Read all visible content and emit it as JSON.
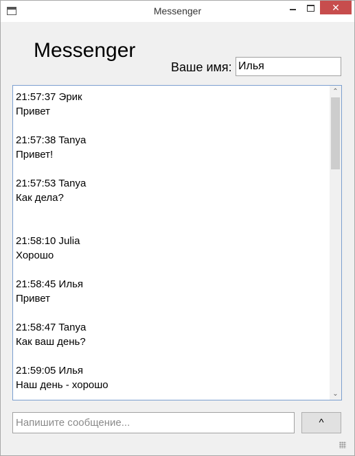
{
  "window": {
    "title": "Messenger",
    "close_glyph": "✕",
    "icons": [
      "app-icon",
      "minimize-icon",
      "maximize-icon",
      "close-icon"
    ]
  },
  "header": {
    "title": "Messenger",
    "name_label": "Ваше имя:",
    "name_value": "Илья"
  },
  "messages": [
    {
      "header": "21:57:37 Эрик",
      "text": "Привет"
    },
    {
      "header": "21:57:38 Tanya",
      "text": "Привет!"
    },
    {
      "header": "21:57:53 Tanya",
      "text": "Как дела?"
    },
    {
      "header": "21:58:10 Julia",
      "text": "Хорошо"
    },
    {
      "header": "21:58:45 Илья",
      "text": "Привет"
    },
    {
      "header": "21:58:47 Tanya",
      "text": "Как ваш день?"
    },
    {
      "header": "21:59:05 Илья",
      "text": "Наш день - хорошо"
    }
  ],
  "scrollbar": {
    "up_glyph": "⌃",
    "down_glyph": "⌄"
  },
  "composer": {
    "placeholder": "Напишите сообщение...",
    "value": "",
    "send_label": "^"
  }
}
